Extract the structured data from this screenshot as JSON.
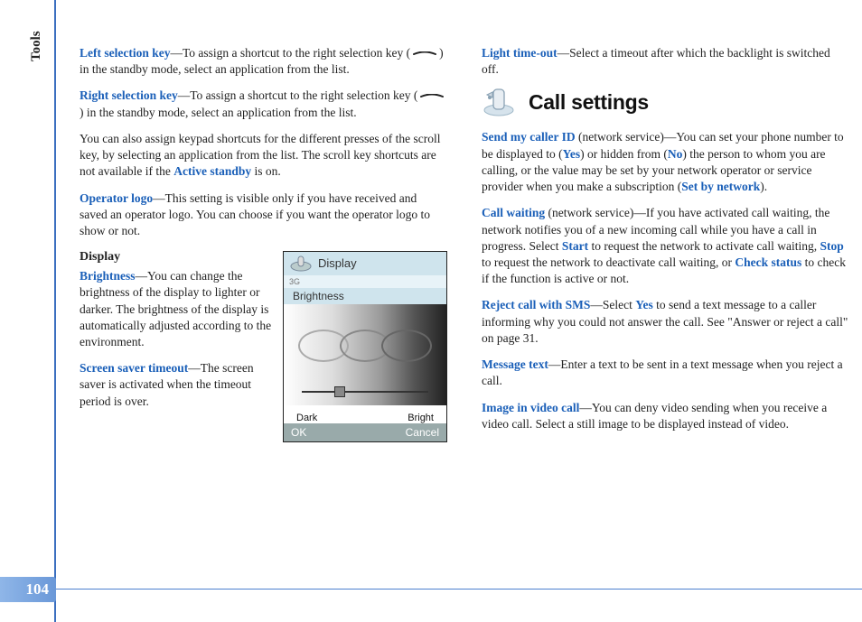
{
  "section_tab": "Tools",
  "page_number": "104",
  "col1": {
    "p1": {
      "label": "Left selection key",
      "t1": "—To assign a shortcut to the right selection key (",
      "t2": ") in the standby mode, select an application from the list."
    },
    "p2": {
      "label": "Right selection key",
      "t1": "—To assign a shortcut to the right selection key (",
      "t2": ") in the standby mode, select an application from the list."
    },
    "p3": {
      "t1": "You can also assign keypad shortcuts for the different presses of the scroll key, by selecting an application from the list. The scroll key shortcuts are not available if the ",
      "kw": "Active standby",
      "t2": " is on."
    },
    "p4": {
      "label": "Operator logo",
      "t1": "—This setting is visible only if you have received and saved an operator logo. You can choose if you want the operator logo to show or not."
    },
    "display": {
      "heading": "Display",
      "p_brightness": {
        "label": "Brightness",
        "t1": "—You can change the brightness of the display to lighter or darker. The brightness of the display is automatically adjusted according to the environment."
      },
      "p_screensaver": {
        "label": "Screen saver timeout",
        "t1": "—The screen saver is activated when the timeout period is over."
      }
    },
    "phone": {
      "title": "Display",
      "status": "3G",
      "tab": "Brightness",
      "dark": "Dark",
      "bright": "Bright",
      "ok": "OK",
      "cancel": "Cancel"
    }
  },
  "col2": {
    "p_light": {
      "label": "Light time-out",
      "t1": "—Select a timeout after which the backlight is switched off."
    },
    "heading": "Call settings",
    "p_caller": {
      "label": "Send my caller ID",
      "t1": " (network service)—You can set your phone number to be displayed to (",
      "yes": "Yes",
      "t2": ") or hidden from (",
      "no": "No",
      "t3": ") the person to whom you are calling, or the value may be set by your network operator or service provider when you make a subscription (",
      "set": "Set by network",
      "t4": ")."
    },
    "p_waiting": {
      "label": "Call waiting",
      "t1": " (network service)—If you have activated call waiting, the network notifies you of a new incoming call while you have a call in progress. Select ",
      "start": "Start",
      "t2": " to request the network to activate call waiting, ",
      "stop": "Stop",
      "t3": " to request the network to deactivate call waiting, or ",
      "check": "Check status",
      "t4": " to check if the function is active or not."
    },
    "p_reject": {
      "label": "Reject call with SMS",
      "t1": "—Select ",
      "yes": "Yes",
      "t2": " to send a text message to a caller informing why you could not answer the call. See \"Answer or reject a call\" on page 31."
    },
    "p_msg": {
      "label": "Message text",
      "t1": "—Enter a text to be sent in a text message when you reject a call."
    },
    "p_image": {
      "label": "Image in video call",
      "t1": "—You can deny video sending when you receive a video call. Select a still image to be displayed instead of video."
    }
  }
}
